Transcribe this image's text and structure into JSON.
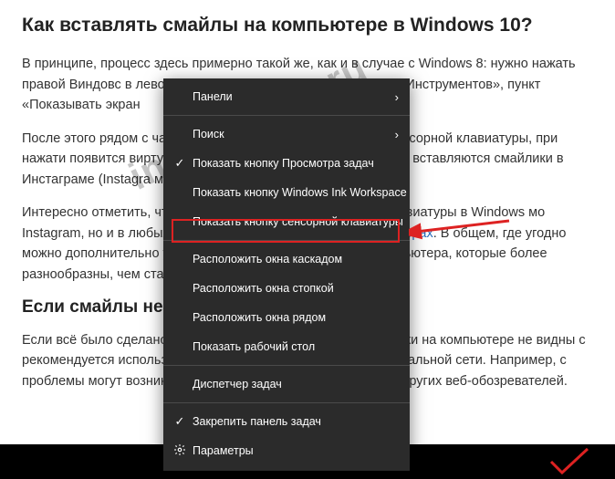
{
  "article": {
    "heading": "Как вставлять смайлы на компьютере в Windows 10?",
    "p1": "В принципе, процесс здесь примерно такой же, как и в случае с Windows 8: нужно нажать правой Виндовс в левом нижнем углу экрана, далее «Панели Инструментов», пункт «Показывать экран",
    "p2_a": "После этого рядом с часами справа снизу появится значок сенсорной клавиатуры, при нажати появится виртуальная клавиатура, с помощью которой вставляются смайлики в Инстаграме (Instagra можно точно так же, как и на смартфоне.",
    "p2_b": "Интересно отметить, что с помощью такой эмодзи-панели клавиатуры в Windows мо Instagram, но и в любых других социальных сетях и ",
    "p2_link": "мессенджерах",
    "p2_c": ". В общем, где угодно можно дополнительно установить наборы символов для компьютера, которые более разнообразны, чем стандартные наборы",
    "subheading": "Если смайлы не отображаются",
    "p3": "Если всё было сделано так как описано выше, однако смайлики на компьютере не видны с рекомендуется использовать другой браузер для входа в социальной сети. Например, с проблемы могут возникнуть у устаревшего Internet Explorer и других веб-обозревателей."
  },
  "menu": {
    "items": [
      {
        "label": "Панели",
        "icon": "",
        "chevron": true
      },
      {
        "label": "Поиск",
        "icon": "",
        "chevron": true
      },
      {
        "label": "Показать кнопку Просмотра задач",
        "icon": "check",
        "chevron": false
      },
      {
        "label": "Показать кнопку Windows Ink Workspace",
        "icon": "",
        "chevron": false
      },
      {
        "label": "Показать кнопку сенсорной клавиатуры",
        "icon": "",
        "chevron": false,
        "highlighted": true
      },
      {
        "label": "Расположить окна каскадом",
        "icon": "",
        "chevron": false
      },
      {
        "label": "Расположить окна стопкой",
        "icon": "",
        "chevron": false
      },
      {
        "label": "Расположить окна рядом",
        "icon": "",
        "chevron": false
      },
      {
        "label": "Показать рабочий стол",
        "icon": "",
        "chevron": false
      },
      {
        "label": "Диспетчер задач",
        "icon": "",
        "chevron": false
      },
      {
        "label": "Закрепить панель задач",
        "icon": "check",
        "chevron": false
      },
      {
        "label": "Параметры",
        "icon": "gear",
        "chevron": false
      }
    ]
  },
  "watermark": "in-stogram.ru",
  "colors": {
    "highlight": "#d22",
    "menu_bg": "#2b2b2b"
  }
}
